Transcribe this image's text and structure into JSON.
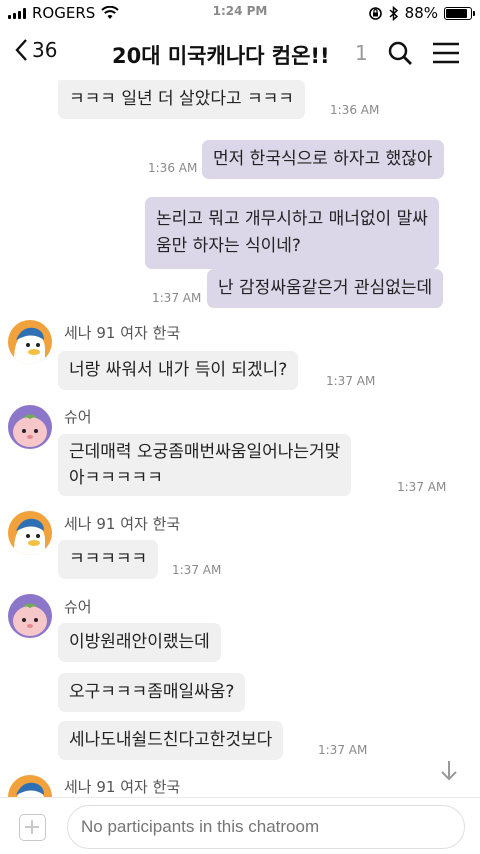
{
  "status_bar": {
    "carrier": "ROGERS",
    "time": "1:24 PM",
    "battery": "88%",
    "battery_level": 0.88
  },
  "header": {
    "back_count": "36",
    "title": "20대 미국캐나다 컴온!!",
    "member_count": "1",
    "icons": [
      "chevron-left-icon",
      "search-icon",
      "menu-icon"
    ]
  },
  "messages": [
    {
      "side": "in",
      "text": "ㅋㅋㅋ 일년 더 살았다고 ㅋㅋㅋ",
      "time": "1:36 AM"
    },
    {
      "side": "out",
      "text": "먼저 한국식으로 하자고 했잖아",
      "time": "1:36 AM"
    },
    {
      "side": "out",
      "lines": [
        "논리고 뭐고 개무시하고 매너없이 말싸",
        "움만 하자는 식이네?"
      ],
      "time": ""
    },
    {
      "side": "out",
      "text": "난 감정싸움같은거 관심없는데",
      "time": "1:37 AM"
    },
    {
      "side": "in",
      "sender": "세나 91 여자 한국",
      "avatar": "sena",
      "text": "너랑 싸워서 내가 득이 되겠니?",
      "time": "1:37 AM"
    },
    {
      "side": "in",
      "sender": "슈어",
      "avatar": "sure",
      "lines": [
        "근데매력  오궁좀매번싸움일어나는거맞",
        "아ㅋㅋㅋㅋㅋ"
      ],
      "time": "1:37 AM"
    },
    {
      "side": "in",
      "sender": "세나 91 여자 한국",
      "avatar": "sena",
      "text": "ㅋㅋㅋㅋㅋ",
      "time": "1:37 AM"
    },
    {
      "side": "in",
      "sender": "슈어",
      "avatar": "sure",
      "text": "이방원래안이랬는데",
      "time": ""
    },
    {
      "side": "in",
      "text": "오구ㅋㅋㅋ좀매일싸움?",
      "time": ""
    },
    {
      "side": "in",
      "text": "세나도내쉴드친다고한것보다",
      "time": "1:37 AM"
    },
    {
      "side": "in",
      "sender": "세나 91 여자 한국",
      "avatar": "sena",
      "text": "",
      "time": ""
    }
  ],
  "input": {
    "placeholder": "No participants in this chatroom"
  },
  "colors": {
    "outgoing_bubble": "#dcd6e9",
    "incoming_bubble": "#f0f0f0",
    "timestamp": "#8a8a8a"
  }
}
